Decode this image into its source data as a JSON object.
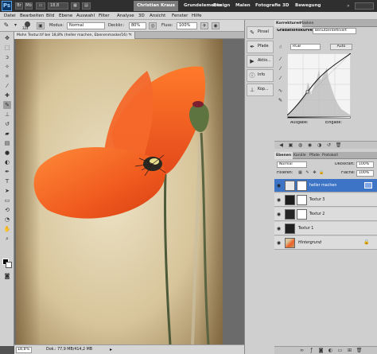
{
  "appbar": {
    "logo": "Ps",
    "buttons": [
      "Br",
      "Mb"
    ],
    "zoom": "18,8",
    "workspaces": [
      "Christian Kraus",
      "Grundelemente",
      "Design",
      "Malen",
      "Fotografie",
      "3D",
      "Bewegung"
    ],
    "overflow": "»"
  },
  "menu": [
    "Datei",
    "Bearbeiten",
    "Bild",
    "Ebene",
    "Auswahl",
    "Filter",
    "Analyse",
    "3D",
    "Ansicht",
    "Fenster",
    "Hilfe"
  ],
  "options": {
    "brush_size": "324",
    "modus_label": "Modus:",
    "modus_value": "Normal",
    "deckkraft_label": "Deckkr.:",
    "deckkraft_value": "80%",
    "fluss_label": "Fluss:",
    "fluss_value": "100%"
  },
  "document": {
    "tab_title": "Mohn Textur.tif bei 18,8% (heller machen, Ebenenmaske/16) *",
    "close": "×"
  },
  "status": {
    "zoom": "18,8%",
    "doc": "Dok.: 77,9 MB/414,2 MB"
  },
  "dock": {
    "items": [
      "Pinsel",
      "Pfade",
      "Aktio...",
      "Info",
      "Kop..."
    ]
  },
  "adjust_panel": {
    "tabs": [
      "Korrekturen",
      "Masken"
    ],
    "title": "Gradationskurven",
    "preset": "Benutzerdefiniert",
    "channel": "RGB",
    "auto_button": "Auto",
    "output_label": "Ausgabe:",
    "input_label": "Eingabe:"
  },
  "layers_panel": {
    "tabs": [
      "Ebenen",
      "Kanäle",
      "Pfade",
      "Protokoll"
    ],
    "mode": "Normal",
    "opacity_label": "Deckkraft:",
    "opacity_value": "100%",
    "lock_label": "Fixieren:",
    "fill_label": "Fläche:",
    "fill_value": "100%",
    "layers": [
      {
        "name": "heller machen",
        "selected": true
      },
      {
        "name": "Textur 3",
        "selected": false
      },
      {
        "name": "Textur 2",
        "selected": false
      },
      {
        "name": "Textur 1",
        "selected": false
      },
      {
        "name": "Hintergrund",
        "selected": false
      }
    ]
  },
  "colors": {
    "accent": "#3d74c6",
    "layer_selected": "#3d74c6"
  }
}
